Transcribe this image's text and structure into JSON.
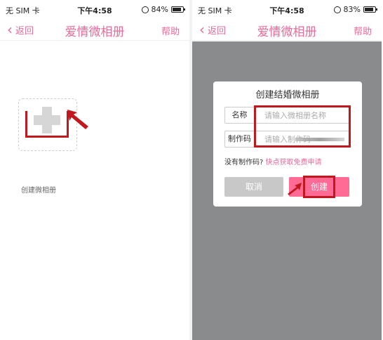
{
  "status_left": {
    "carrier": "无 SIM 卡",
    "time": "下午4:58",
    "battery": "84%"
  },
  "status_right": {
    "carrier": "无 SIM 卡",
    "time": "下午4:58",
    "battery": "83%"
  },
  "nav": {
    "back_label": "返回",
    "title": "爱情微相册",
    "help_label": "帮助"
  },
  "left_screen": {
    "create_label": "创建微相册"
  },
  "dialog": {
    "title": "创建结婚微相册",
    "name_label": "名称",
    "name_placeholder": "请输入微相册名称",
    "code_label": "制作码",
    "code_placeholder": "请输入制作码",
    "no_code_text": "没有制作码?",
    "get_free_link": "快点获取免费申请",
    "cancel_label": "取消",
    "create_label": "创建"
  },
  "colors": {
    "accent": "#e96c96",
    "highlight": "#c0181e",
    "create_button": "#ff6b95",
    "overlay": "#8a8b8d"
  }
}
